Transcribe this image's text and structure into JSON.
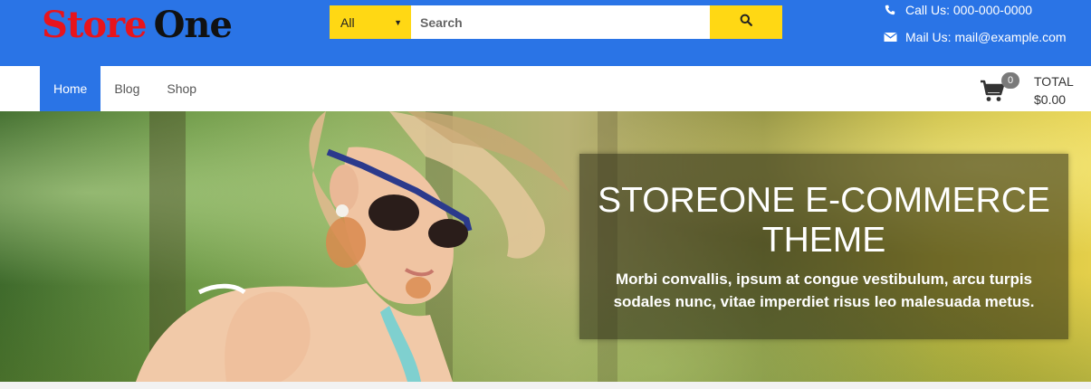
{
  "header": {
    "logo": {
      "word1": "Store",
      "word2": "One"
    },
    "search": {
      "category_selected": "All",
      "placeholder": "Search",
      "value": ""
    },
    "contact": {
      "phone": "Call Us: 000-000-0000",
      "email": "Mail Us: mail@example.com"
    }
  },
  "nav": {
    "items": [
      {
        "label": "Home",
        "active": true
      },
      {
        "label": "Blog",
        "active": false
      },
      {
        "label": "Shop",
        "active": false
      }
    ],
    "cart": {
      "count": "0",
      "total_label": "TOTAL",
      "total_value": "$0.00"
    }
  },
  "hero": {
    "title": "STOREONE E-COMMERCE THEME",
    "text": "Morbi convallis, ipsum at congue vestibulum, arcu turpis sodales nunc, vitae imperdiet risus leo malesuada metus."
  },
  "colors": {
    "brand_blue": "#2a74e6",
    "accent_yellow": "#ffd814",
    "logo_red": "#e8141c"
  },
  "icons": [
    "search-icon",
    "phone-icon",
    "envelope-icon",
    "cart-icon",
    "caret-down-icon"
  ]
}
